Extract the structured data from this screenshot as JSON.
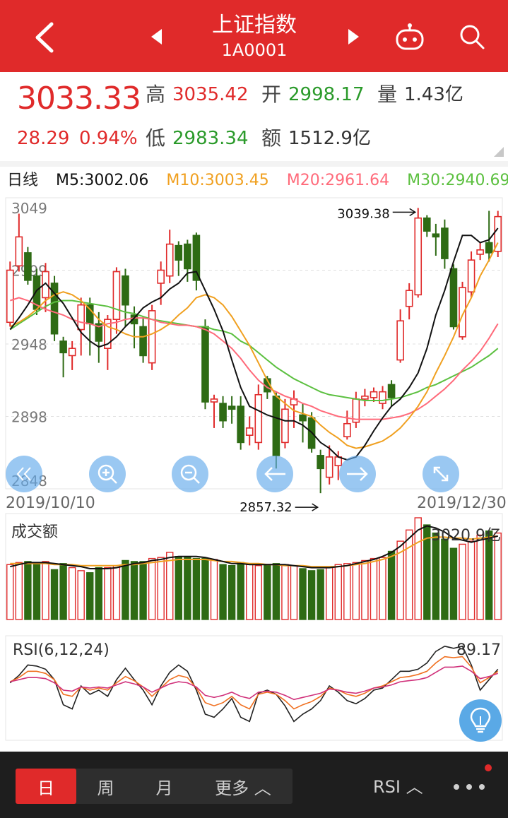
{
  "header": {
    "title": "上证指数",
    "code": "1A0001"
  },
  "quote": {
    "price": "3033.33",
    "change": "28.29",
    "change_pct": "0.94%",
    "high_label": "高",
    "high": "3035.42",
    "open_label": "开",
    "open": "2998.17",
    "volume_label": "量",
    "volume": "1.43亿",
    "low_label": "低",
    "low": "2983.34",
    "amount_label": "额",
    "amount": "1512.9亿"
  },
  "ma_legend": {
    "period": "日线",
    "m5": "M5:3002.06",
    "m10": "M10:3003.45",
    "m20": "M20:2961.64",
    "m30": "M30:2940.69"
  },
  "colors": {
    "up": "#e02a2a",
    "down": "#2e6b14",
    "m5": "#111111",
    "m10": "#f0a020",
    "m20": "#ff6a7a",
    "m30": "#5cc040",
    "accent": "#e02a2a"
  },
  "chart_data": [
    {
      "type": "candlestick",
      "y_ticks": [
        "3049",
        "2999",
        "2948",
        "2898",
        "2848"
      ],
      "ylim": [
        2848,
        3049
      ],
      "start_date": "2019/10/10",
      "end_date": "2019/12/30",
      "annotations": {
        "max": "3039.38",
        "min": "2857.32"
      },
      "candles": [
        [
          2963,
          2999,
          2960,
          3005
        ],
        [
          3002,
          3022,
          2998,
          3038
        ],
        [
          3011,
          2992,
          2989,
          3015
        ],
        [
          2995,
          2972,
          2968,
          3000
        ],
        [
          2980,
          2998,
          2970,
          3004
        ],
        [
          2990,
          2955,
          2950,
          2995
        ],
        [
          2950,
          2942,
          2925,
          2953
        ],
        [
          2940,
          2945,
          2930,
          2950
        ],
        [
          2958,
          2975,
          2940,
          2980
        ],
        [
          2975,
          2962,
          2940,
          2980
        ],
        [
          2962,
          2950,
          2935,
          2970
        ],
        [
          2945,
          2965,
          2930,
          2968
        ],
        [
          2965,
          2998,
          2955,
          3001
        ],
        [
          2995,
          2975,
          2960,
          3000
        ],
        [
          2968,
          2962,
          2945,
          2974
        ],
        [
          2960,
          2940,
          2935,
          2967
        ],
        [
          2935,
          2971,
          2930,
          2975
        ],
        [
          2990,
          2999,
          2975,
          3005
        ],
        [
          2995,
          3017,
          2990,
          3027
        ],
        [
          3016,
          3006,
          2995,
          3019
        ],
        [
          3017,
          3000,
          2991,
          3020
        ],
        [
          3023,
          2992,
          2985,
          3025
        ],
        [
          2960,
          2908,
          2903,
          2965
        ],
        [
          2908,
          2910,
          2890,
          2913
        ],
        [
          2907,
          2895,
          2890,
          2912
        ],
        [
          2905,
          2903,
          2893,
          2912
        ],
        [
          2905,
          2880,
          2875,
          2912
        ],
        [
          2885,
          2890,
          2878,
          2898
        ],
        [
          2880,
          2913,
          2875,
          2920
        ],
        [
          2924,
          2915,
          2910,
          2926
        ],
        [
          2912,
          2871,
          2862,
          2915
        ],
        [
          2880,
          2903,
          2876,
          2910
        ],
        [
          2906,
          2910,
          2890,
          2916
        ],
        [
          2899,
          2895,
          2880,
          2907
        ],
        [
          2897,
          2876,
          2873,
          2901
        ],
        [
          2871,
          2862,
          2845,
          2875
        ],
        [
          2856,
          2870,
          2851,
          2878
        ],
        [
          2864,
          2870,
          2854,
          2874
        ],
        [
          2884,
          2893,
          2882,
          2902
        ],
        [
          2894,
          2910,
          2890,
          2915
        ],
        [
          2910,
          2912,
          2905,
          2917
        ],
        [
          2911,
          2915,
          2908,
          2918
        ],
        [
          2907,
          2915,
          2903,
          2919
        ],
        [
          2920,
          2911,
          2905,
          2923
        ],
        [
          2937,
          2964,
          2935,
          2972
        ],
        [
          2974,
          2985,
          2965,
          2990
        ],
        [
          2982,
          3035,
          2980,
          3042
        ],
        [
          3035,
          3026,
          3022,
          3037
        ],
        [
          3024,
          3022,
          3009,
          3031
        ],
        [
          3028,
          3007,
          3000,
          3034
        ],
        [
          3000,
          2960,
          2958,
          3003
        ],
        [
          2953,
          2987,
          2951,
          2991
        ],
        [
          2984,
          3006,
          2980,
          3012
        ],
        [
          3010,
          3013,
          3006,
          3018
        ],
        [
          3018,
          3011,
          3005,
          3040
        ],
        [
          3012,
          3036,
          3008,
          3040
        ]
      ],
      "ma5": [
        2958,
        2966,
        2975,
        2985,
        2990,
        2983,
        2976,
        2966,
        2956,
        2950,
        2946,
        2948,
        2953,
        2960,
        2966,
        2973,
        2977,
        2980,
        2986,
        2990,
        2997,
        2998,
        2985,
        2972,
        2957,
        2937,
        2918,
        2905,
        2902,
        2899,
        2897,
        2895,
        2895,
        2892,
        2887,
        2880,
        2876,
        2870,
        2868,
        2870,
        2878,
        2888,
        2897,
        2905,
        2910,
        2918,
        2928,
        2945,
        2968,
        2985,
        3005,
        3023,
        3023,
        3018,
        3020,
        3028
      ],
      "ma10": [
        2960,
        2963,
        2967,
        2972,
        2978,
        2982,
        2984,
        2982,
        2978,
        2972,
        2965,
        2960,
        2958,
        2955,
        2953,
        2953,
        2955,
        2958,
        2962,
        2968,
        2973,
        2980,
        2982,
        2980,
        2975,
        2967,
        2957,
        2947,
        2935,
        2923,
        2912,
        2907,
        2902,
        2900,
        2898,
        2892,
        2887,
        2883,
        2878,
        2876,
        2877,
        2879,
        2881,
        2885,
        2890,
        2897,
        2905,
        2915,
        2928,
        2940,
        2953,
        2968,
        2980,
        2995,
        3006,
        3018
      ],
      "ma20": [
        2978,
        2980,
        2978,
        2975,
        2972,
        2970,
        2968,
        2965,
        2963,
        2962,
        2960,
        2962,
        2963,
        2965,
        2966,
        2966,
        2965,
        2963,
        2962,
        2961,
        2961,
        2960,
        2958,
        2955,
        2950,
        2945,
        2938,
        2930,
        2923,
        2918,
        2915,
        2912,
        2910,
        2907,
        2905,
        2902,
        2900,
        2898,
        2897,
        2896,
        2896,
        2896,
        2896,
        2897,
        2898,
        2900,
        2903,
        2907,
        2912,
        2917,
        2923,
        2930,
        2936,
        2943,
        2952,
        2962
      ],
      "ma30": [
        2958,
        2962,
        2966,
        2970,
        2974,
        2977,
        2978,
        2978,
        2977,
        2976,
        2975,
        2974,
        2972,
        2970,
        2969,
        2967,
        2965,
        2964,
        2963,
        2962,
        2961,
        2960,
        2960,
        2958,
        2957,
        2955,
        2950,
        2947,
        2942,
        2937,
        2932,
        2928,
        2924,
        2921,
        2918,
        2915,
        2913,
        2912,
        2911,
        2910,
        2909,
        2909,
        2909,
        2910,
        2911,
        2913,
        2915,
        2918,
        2920,
        2923,
        2926,
        2929,
        2932,
        2936,
        2940,
        2945
      ]
    },
    {
      "type": "bar",
      "title": "成交额",
      "latest": "3020.9亿",
      "ylim": [
        0,
        1.0
      ],
      "values": [
        0.54,
        0.56,
        0.57,
        0.56,
        0.57,
        0.49,
        0.55,
        0.51,
        0.48,
        0.46,
        0.51,
        0.51,
        0.53,
        0.58,
        0.57,
        0.57,
        0.6,
        0.61,
        0.66,
        0.62,
        0.62,
        0.6,
        0.6,
        0.59,
        0.54,
        0.53,
        0.56,
        0.54,
        0.53,
        0.53,
        0.55,
        0.54,
        0.53,
        0.5,
        0.48,
        0.49,
        0.51,
        0.54,
        0.55,
        0.56,
        0.58,
        0.6,
        0.61,
        0.67,
        0.77,
        0.88,
        1.0,
        0.93,
        0.85,
        0.79,
        0.7,
        0.74,
        0.77,
        0.83,
        0.87,
        0.85
      ],
      "ma_short": [
        0.52,
        0.54,
        0.56,
        0.56,
        0.56,
        0.55,
        0.54,
        0.53,
        0.52,
        0.5,
        0.5,
        0.5,
        0.51,
        0.53,
        0.55,
        0.56,
        0.58,
        0.59,
        0.61,
        0.62,
        0.62,
        0.62,
        0.61,
        0.59,
        0.57,
        0.55,
        0.55,
        0.54,
        0.54,
        0.54,
        0.54,
        0.54,
        0.53,
        0.52,
        0.51,
        0.51,
        0.51,
        0.52,
        0.53,
        0.55,
        0.57,
        0.59,
        0.62,
        0.66,
        0.72,
        0.8,
        0.88,
        0.92,
        0.9,
        0.86,
        0.8,
        0.78,
        0.76,
        0.78,
        0.8,
        0.82
      ],
      "ma_long": [
        0.55,
        0.55,
        0.55,
        0.55,
        0.55,
        0.54,
        0.54,
        0.54,
        0.53,
        0.53,
        0.53,
        0.53,
        0.53,
        0.54,
        0.54,
        0.55,
        0.56,
        0.57,
        0.58,
        0.59,
        0.59,
        0.59,
        0.59,
        0.58,
        0.57,
        0.57,
        0.56,
        0.55,
        0.55,
        0.54,
        0.54,
        0.53,
        0.53,
        0.53,
        0.52,
        0.52,
        0.52,
        0.52,
        0.53,
        0.54,
        0.55,
        0.57,
        0.59,
        0.62,
        0.66,
        0.71,
        0.76,
        0.8,
        0.81,
        0.81,
        0.8,
        0.8,
        0.79,
        0.8,
        0.81,
        0.82
      ]
    },
    {
      "type": "line",
      "title": "RSI(6,12,24)",
      "latest": "89.17",
      "ylim": [
        0,
        100
      ],
      "series": [
        {
          "name": "RSI6",
          "values": [
            55,
            62,
            72,
            71,
            68,
            58,
            34,
            30,
            52,
            44,
            48,
            42,
            58,
            69,
            58,
            48,
            34,
            52,
            65,
            72,
            66,
            48,
            25,
            22,
            30,
            40,
            22,
            18,
            45,
            48,
            44,
            33,
            18,
            25,
            30,
            38,
            52,
            46,
            38,
            35,
            40,
            48,
            50,
            58,
            66,
            66,
            68,
            74,
            85,
            90,
            88,
            90,
            72,
            48,
            58,
            68
          ]
        },
        {
          "name": "RSI12",
          "values": [
            56,
            60,
            66,
            66,
            64,
            58,
            44,
            42,
            51,
            48,
            50,
            48,
            55,
            61,
            57,
            51,
            42,
            50,
            58,
            62,
            60,
            50,
            36,
            33,
            36,
            42,
            34,
            30,
            44,
            46,
            44,
            38,
            30,
            34,
            37,
            42,
            50,
            48,
            44,
            42,
            45,
            50,
            52,
            56,
            60,
            61,
            63,
            66,
            74,
            80,
            79,
            80,
            70,
            55,
            60,
            66
          ]
        },
        {
          "name": "RSI24",
          "values": [
            56,
            58,
            60,
            60,
            59,
            55,
            48,
            47,
            51,
            50,
            51,
            50,
            53,
            56,
            54,
            51,
            46,
            50,
            54,
            56,
            55,
            51,
            43,
            41,
            43,
            46,
            42,
            40,
            46,
            47,
            46,
            43,
            39,
            41,
            43,
            45,
            49,
            48,
            46,
            45,
            47,
            50,
            51,
            53,
            56,
            57,
            58,
            60,
            65,
            70,
            70,
            71,
            66,
            59,
            61,
            64
          ]
        }
      ]
    }
  ],
  "controls": {
    "left_arrows": "«",
    "left": "←",
    "right": "→"
  },
  "bottom_bar": {
    "tab_day": "日",
    "tab_week": "周",
    "tab_month": "月",
    "tab_more": "更多 ︿",
    "indicator": "RSI ︿",
    "more_menu": "•••"
  }
}
